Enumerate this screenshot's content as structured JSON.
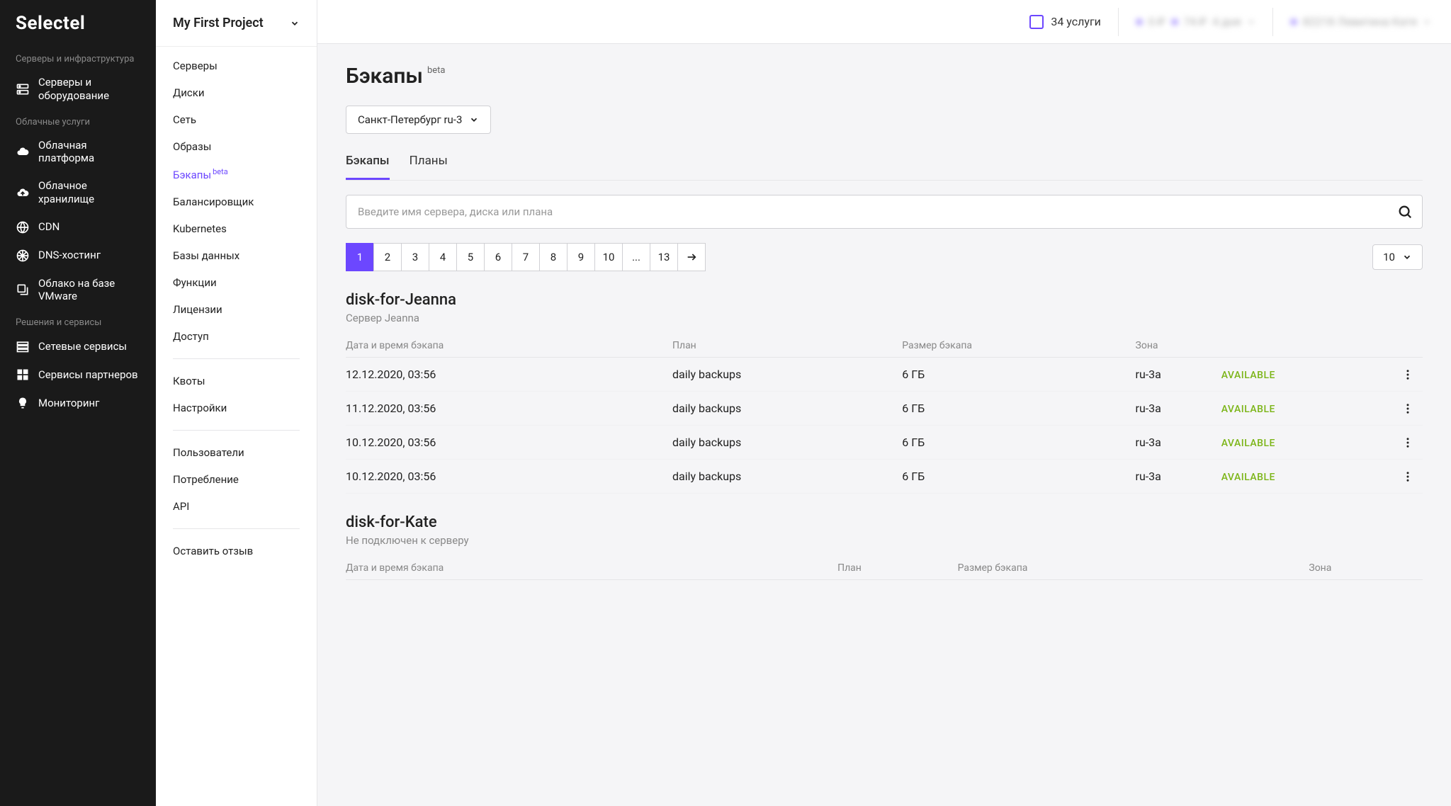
{
  "logo": "Selectel",
  "sidebar": {
    "sections": [
      {
        "header": "Серверы и инфраструктура",
        "items": [
          {
            "label": "Серверы и оборудование",
            "icon": "servers"
          }
        ]
      },
      {
        "header": "Облачные услуги",
        "items": [
          {
            "label": "Облачная платформа",
            "icon": "cloud"
          },
          {
            "label": "Облачное хранилище",
            "icon": "cloud-upload"
          },
          {
            "label": "CDN",
            "icon": "globe"
          },
          {
            "label": "DNS-хостинг",
            "icon": "globe-grid"
          },
          {
            "label": "Облако на базе VMware",
            "icon": "stack"
          }
        ]
      },
      {
        "header": "Решения и сервисы",
        "items": [
          {
            "label": "Сетевые сервисы",
            "icon": "list"
          },
          {
            "label": "Сервисы партнеров",
            "icon": "grid"
          },
          {
            "label": "Мониторинг",
            "icon": "bulb"
          }
        ]
      }
    ]
  },
  "subpanel": {
    "project": "My First Project",
    "items": [
      "Серверы",
      "Диски",
      "Сеть",
      "Образы"
    ],
    "active": {
      "label": "Бэкапы",
      "beta": "beta"
    },
    "items2": [
      "Балансировщик",
      "Kubernetes",
      "Базы данных",
      "Функции",
      "Лицензии",
      "Доступ"
    ],
    "items3": [
      "Квоты",
      "Настройки"
    ],
    "items4": [
      "Пользователи",
      "Потребление",
      "API"
    ],
    "items5": [
      "Оставить отзыв"
    ]
  },
  "topbar": {
    "services": "34 услуги",
    "balance1": "0 ₽",
    "balance2": "74 ₽",
    "days": "4 дня",
    "account": "82218   Левитина Катя"
  },
  "page": {
    "title": "Бэкапы",
    "beta": "beta",
    "region": "Санкт-Петербург ru-3",
    "tabs": [
      "Бэкапы",
      "Планы"
    ],
    "active_tab": 0,
    "search_placeholder": "Введите имя сервера, диска или плана",
    "pages": [
      "1",
      "2",
      "3",
      "4",
      "5",
      "6",
      "7",
      "8",
      "9",
      "10",
      "...",
      "13"
    ],
    "active_page": 0,
    "per_page": "10"
  },
  "groups": [
    {
      "title": "disk-for-Jeanna",
      "subtitle": "Сервер Jeanna",
      "columns": [
        "Дата и время бэкапа",
        "План",
        "Размер бэкапа",
        "Зона"
      ],
      "rows": [
        {
          "date": "12.12.2020, 03:56",
          "plan": "daily backups",
          "size": "6 ГБ",
          "zone": "ru-3a",
          "status": "AVAILABLE"
        },
        {
          "date": "11.12.2020, 03:56",
          "plan": "daily backups",
          "size": "6 ГБ",
          "zone": "ru-3a",
          "status": "AVAILABLE"
        },
        {
          "date": "10.12.2020, 03:56",
          "plan": "daily backups",
          "size": "6 ГБ",
          "zone": "ru-3a",
          "status": "AVAILABLE"
        },
        {
          "date": "10.12.2020, 03:56",
          "plan": "daily backups",
          "size": "6 ГБ",
          "zone": "ru-3a",
          "status": "AVAILABLE"
        }
      ]
    },
    {
      "title": "disk-for-Kate",
      "subtitle": "Не подключен к серверу",
      "columns": [
        "Дата и время бэкапа",
        "План",
        "Размер бэкапа",
        "Зона"
      ],
      "rows": []
    }
  ]
}
